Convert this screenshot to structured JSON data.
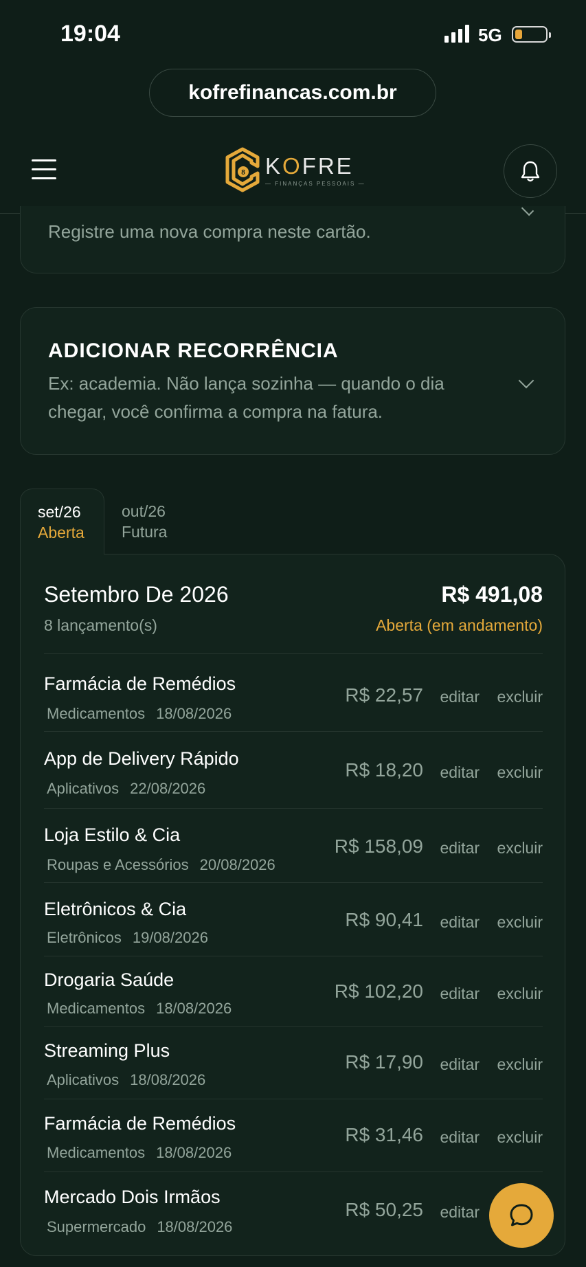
{
  "status_bar": {
    "time": "19:04",
    "network": "5G",
    "battery_color": "#e7a63a"
  },
  "browser": {
    "url": "kofrefinancas.com.br"
  },
  "header": {
    "logo_name_pre": "K",
    "logo_name_o": "O",
    "logo_name_post": "FRE",
    "logo_sub": "— FINANÇAS PESSOAIS —",
    "menu_icon": "hamburger-icon",
    "bell_icon": "bell-icon"
  },
  "purchase_card": {
    "description": "Registre uma nova compra neste cartão."
  },
  "recurrence_card": {
    "title": "ADICIONAR RECORRÊNCIA",
    "description": "Ex: academia. Não lança sozinha — quando o dia chegar, você confirma a compra na fatura."
  },
  "tabs": [
    {
      "month": "set/26",
      "status": "Aberta"
    },
    {
      "month": "out/26",
      "status": "Futura"
    }
  ],
  "invoice": {
    "title": "Setembro De 2026",
    "count": "8 lançamento(s)",
    "total": "R$ 491,08",
    "status": "Aberta (em andamento)",
    "edit_label": "editar",
    "delete_label": "excluir",
    "items": [
      {
        "name": "Farmácia de Remédios",
        "category": "Medicamentos",
        "date": "18/08/2026",
        "amount": "R$ 22,57"
      },
      {
        "name": "App de Delivery Rápido",
        "category": "Aplicativos",
        "date": "22/08/2026",
        "amount": "R$ 18,20"
      },
      {
        "name": "Loja Estilo & Cia",
        "category": "Roupas e Acessórios",
        "date": "20/08/2026",
        "amount": "R$ 158,09"
      },
      {
        "name": "Eletrônicos & Cia",
        "category": "Eletrônicos",
        "date": "19/08/2026",
        "amount": "R$ 90,41"
      },
      {
        "name": "Drogaria Saúde",
        "category": "Medicamentos",
        "date": "18/08/2026",
        "amount": "R$ 102,20"
      },
      {
        "name": "Streaming Plus",
        "category": "Aplicativos",
        "date": "18/08/2026",
        "amount": "R$ 17,90"
      },
      {
        "name": "Farmácia de Remédios",
        "category": "Medicamentos",
        "date": "18/08/2026",
        "amount": "R$ 31,46"
      },
      {
        "name": "Mercado Dois Irmãos",
        "category": "Supermercado",
        "date": "18/08/2026",
        "amount": "R$ 50,25"
      }
    ]
  },
  "colors": {
    "accent": "#e5a93a",
    "background": "#0f1e18",
    "card": "#12231c",
    "muted_text": "#93a59b"
  },
  "chat_fab": {
    "icon": "chat-bubble-icon"
  }
}
